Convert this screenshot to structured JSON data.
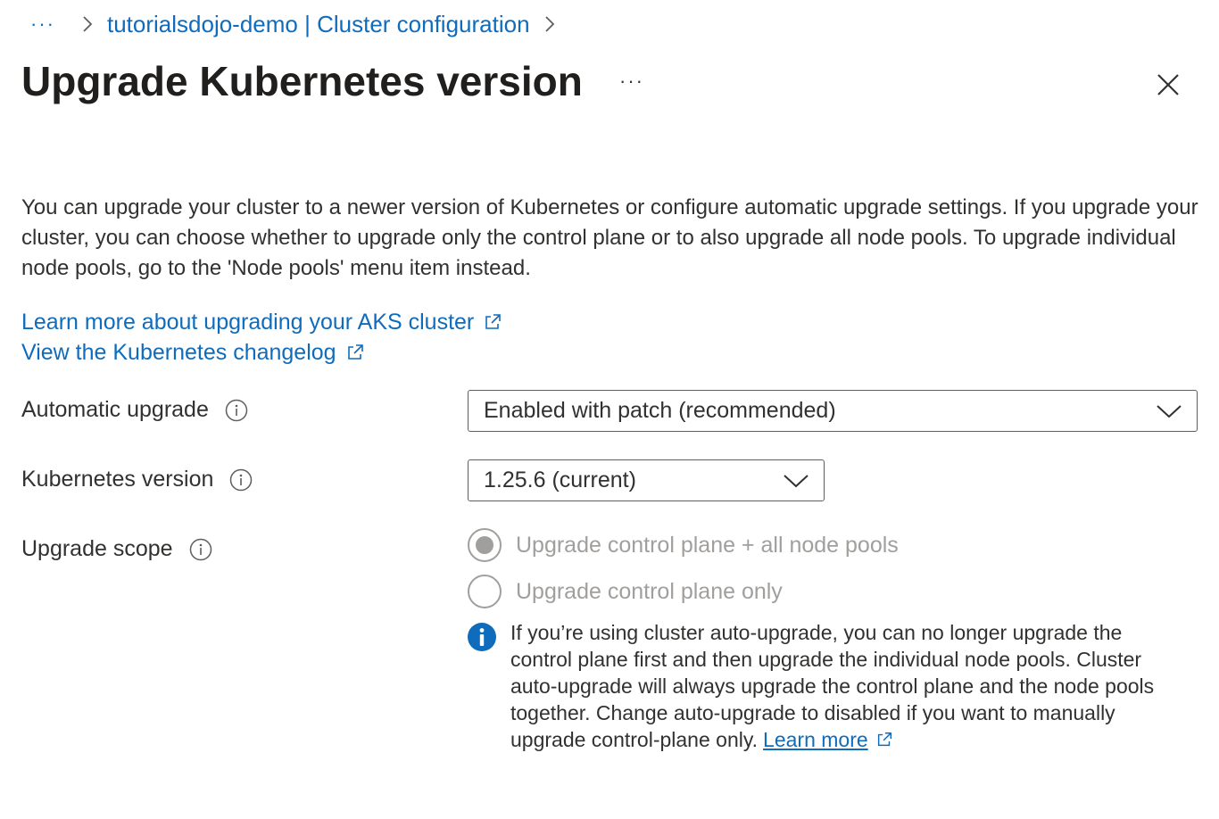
{
  "breadcrumb": {
    "ellipsis": "···",
    "item": "tutorialsdojo-demo | Cluster configuration"
  },
  "title": "Upgrade Kubernetes version",
  "title_more": "···",
  "description": "You can upgrade your cluster to a newer version of Kubernetes or configure automatic upgrade settings. If you upgrade your cluster, you can choose whether to upgrade only the control plane or to also upgrade all node pools. To upgrade individual node pools, go to the 'Node pools' menu item instead.",
  "links": {
    "learn_more": "Learn more about upgrading your AKS cluster",
    "changelog": "View the Kubernetes changelog"
  },
  "form": {
    "automatic_upgrade": {
      "label": "Automatic upgrade",
      "value": "Enabled with patch (recommended)"
    },
    "kubernetes_version": {
      "label": "Kubernetes version",
      "value": "1.25.6 (current)"
    },
    "upgrade_scope": {
      "label": "Upgrade scope",
      "options": [
        {
          "label": "Upgrade control plane + all node pools",
          "selected": true
        },
        {
          "label": "Upgrade control plane only",
          "selected": false
        }
      ]
    }
  },
  "info_message": {
    "text": "If you’re using cluster auto-upgrade, you can no longer upgrade the control plane first and then upgrade the individual node pools. Cluster auto-upgrade will always upgrade the control plane and the node pools together. Change auto-upgrade to disabled if you want to manually upgrade control-plane only.",
    "link": "Learn more"
  },
  "colors": {
    "link": "#0f6cbd",
    "disabled": "#a19f9d",
    "info": "#0f6cbd"
  }
}
